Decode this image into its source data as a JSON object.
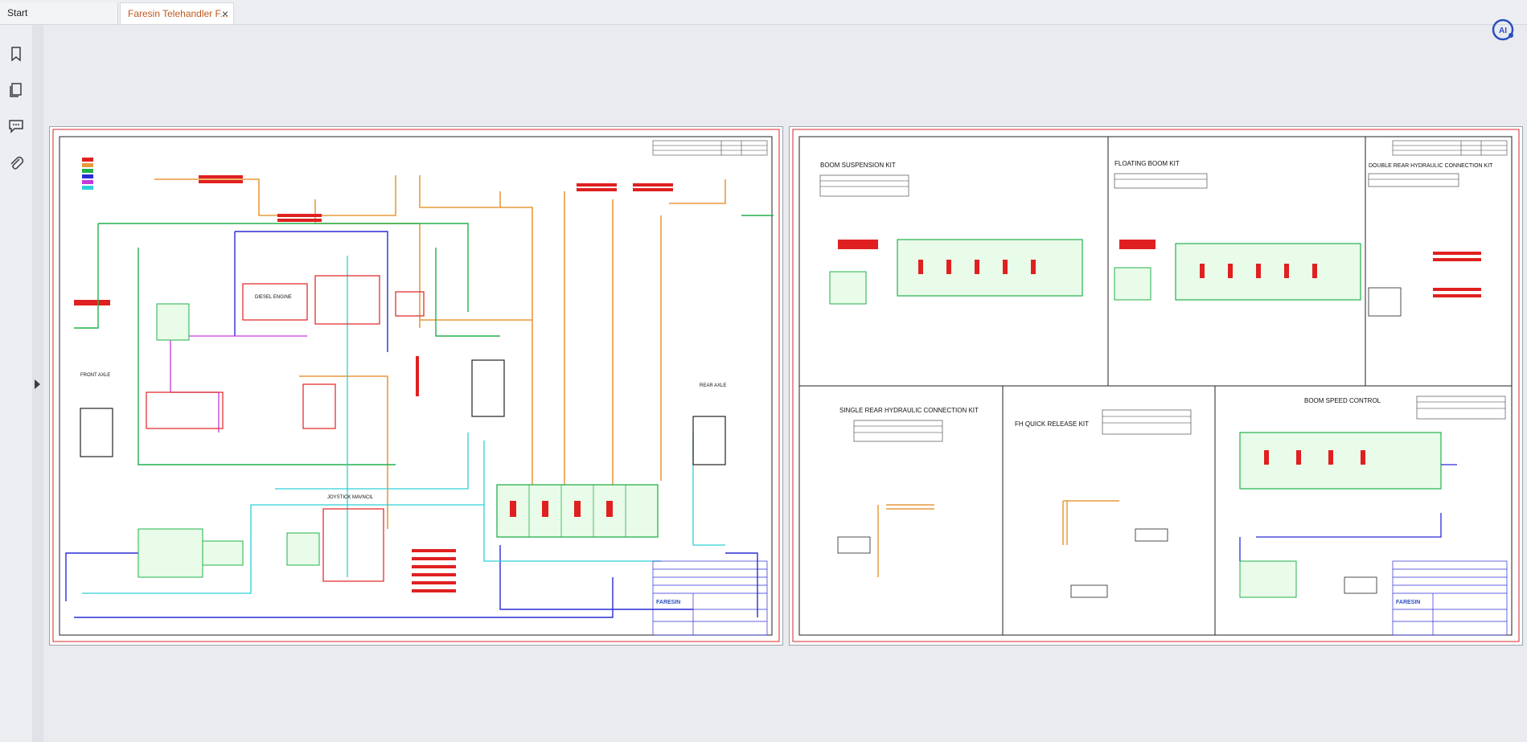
{
  "tabs": [
    {
      "label": "Start",
      "active": false
    },
    {
      "label": "Faresin Telehandler F...",
      "active": true,
      "close": "×"
    }
  ],
  "sidebar": {
    "icons": [
      "bookmark-icon",
      "pages-icon",
      "comment-icon",
      "attachment-icon"
    ]
  },
  "logo": {
    "text": "AI"
  },
  "pages": {
    "left": {
      "texts": {
        "front_axle": "FRONT AXLE",
        "rear_axle": "REAR AXLE",
        "joystick": "JOYSTICK MAVNCIL",
        "diesel": "DIESEL ENGINE",
        "title_brand": "FARESIN"
      }
    },
    "right": {
      "sections": {
        "boom_suspension": "BOOM SUSPENSION KIT",
        "floating_boom": "FLOATING BOOM KIT",
        "double_rear": "DOUBLE REAR HYDRAULIC CONNECTION KIT",
        "single_rear": "SINGLE REAR HYDRAULIC CONNECTION KIT",
        "fh_quick": "FH QUICK RELEASE KIT",
        "boom_speed": "BOOM SPEED CONTROL"
      },
      "title_brand": "FARESIN"
    }
  },
  "colors": {
    "accent": "#c0581e",
    "page_border": "#d9252a",
    "line_green": "#22b14c",
    "line_blue": "#2b2bd6",
    "line_cyan": "#2ed0d8",
    "line_orange": "#e99a3c",
    "line_magenta": "#c43ad9",
    "line_red": "#e02020"
  }
}
